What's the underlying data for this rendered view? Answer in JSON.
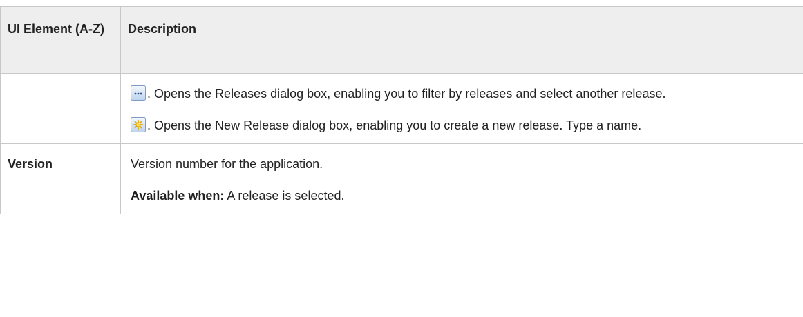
{
  "table": {
    "header": {
      "col1": "UI Element (A-Z)",
      "col2": "Description"
    },
    "row1": {
      "label": "",
      "para1_text": ". Opens the Releases dialog box, enabling you to filter by releases and select another release.",
      "para1_icon": "ellipsis-button-icon",
      "para2_text": ". Opens the New Release dialog box, enabling you to create a new release. Type a name.",
      "para2_icon": "new-item-star-icon"
    },
    "row2": {
      "label": "Version",
      "para1_text": "Version number for the application.",
      "para2_bold": "Available when:",
      "para2_text": " A release is selected."
    }
  }
}
